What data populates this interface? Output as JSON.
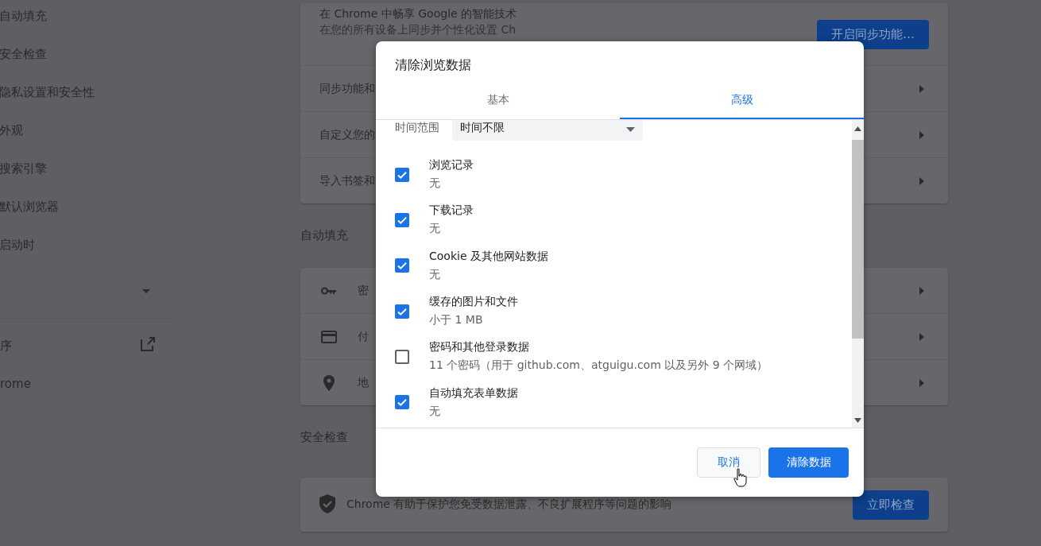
{
  "sidebar": {
    "items": [
      {
        "label": "自动填充"
      },
      {
        "label": "安全检查"
      },
      {
        "label": "隐私设置和安全性"
      },
      {
        "label": "外观"
      },
      {
        "label": "搜索引擎"
      },
      {
        "label": "默认浏览器"
      },
      {
        "label": "启动时"
      }
    ],
    "links": [
      {
        "label": "序",
        "kind": "external"
      },
      {
        "label": "rome",
        "kind": "plain"
      }
    ]
  },
  "sync_card": {
    "title": "在 Chrome 中畅享 Google 的智能技术",
    "subtitle": "在您的所有设备上同步并个性化设置 Ch",
    "button": "开启同步功能…",
    "rows": [
      "同步功能和",
      "自定义您的",
      "导入书签和"
    ]
  },
  "autofill": {
    "heading": "自动填充",
    "rows": [
      {
        "kind": "key",
        "label": "密"
      },
      {
        "kind": "card",
        "label": "付"
      },
      {
        "kind": "pin",
        "label": "地"
      }
    ]
  },
  "safety": {
    "heading": "安全检查",
    "text": "Chrome 有助于保护您免受数据泄露、不良扩展程序等问题的影响",
    "button": "立即检查"
  },
  "dialog": {
    "title": "清除浏览数据",
    "tabs": [
      {
        "label": "基本",
        "selected": false
      },
      {
        "label": "高级",
        "selected": true
      }
    ],
    "time_range": {
      "label": "时间范围",
      "value": "时间不限"
    },
    "items": [
      {
        "label": "浏览记录",
        "detail": "无",
        "checked": true
      },
      {
        "label": "下载记录",
        "detail": "无",
        "checked": true
      },
      {
        "label": "Cookie 及其他网站数据",
        "detail": "无",
        "checked": true
      },
      {
        "label": "缓存的图片和文件",
        "detail": "小于 1 MB",
        "checked": true
      },
      {
        "label": "密码和其他登录数据",
        "detail": "11 个密码（用于 github.com、atguigu.com 以及另外 9 个网域）",
        "checked": false
      },
      {
        "label": "自动填充表单数据",
        "detail": "无",
        "checked": true
      }
    ],
    "buttons": [
      {
        "label": "取消",
        "kind": "secondary"
      },
      {
        "label": "清除数据",
        "kind": "primary"
      }
    ]
  }
}
